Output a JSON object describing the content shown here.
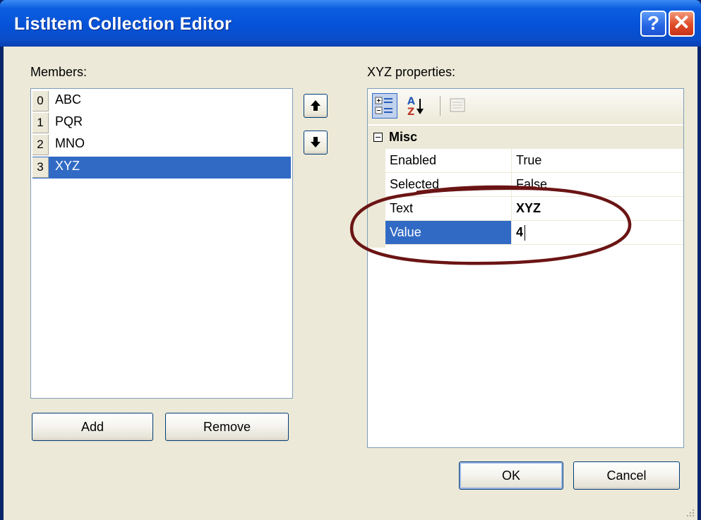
{
  "window": {
    "title": "ListItem Collection Editor",
    "help_glyph": "?",
    "close_glyph": "✕"
  },
  "members": {
    "label": "Members:",
    "items": [
      {
        "index": "0",
        "text": "ABC"
      },
      {
        "index": "1",
        "text": "PQR"
      },
      {
        "index": "2",
        "text": "MNO"
      },
      {
        "index": "3",
        "text": "XYZ"
      }
    ],
    "selected_index": 3,
    "move_up_icon": "arrow-up-icon",
    "move_down_icon": "arrow-down-icon"
  },
  "buttons": {
    "add": "Add",
    "remove": "Remove",
    "ok": "OK",
    "cancel": "Cancel"
  },
  "properties": {
    "label": "XYZ properties:",
    "toolbar_icons": [
      "categorized-icon",
      "alphabetical-icon",
      "property-pages-icon"
    ],
    "category": "Misc",
    "rows": [
      {
        "name": "Enabled",
        "value": "True"
      },
      {
        "name": "Selected",
        "value": "False"
      },
      {
        "name": "Text",
        "value": "XYZ"
      },
      {
        "name": "Value",
        "value": "4"
      }
    ],
    "selected_row": "Value"
  },
  "colors": {
    "selection": "#316ac5",
    "annotation": "#6b1414",
    "dialog_face": "#ece9d8",
    "title_bar": "#0552d8"
  }
}
